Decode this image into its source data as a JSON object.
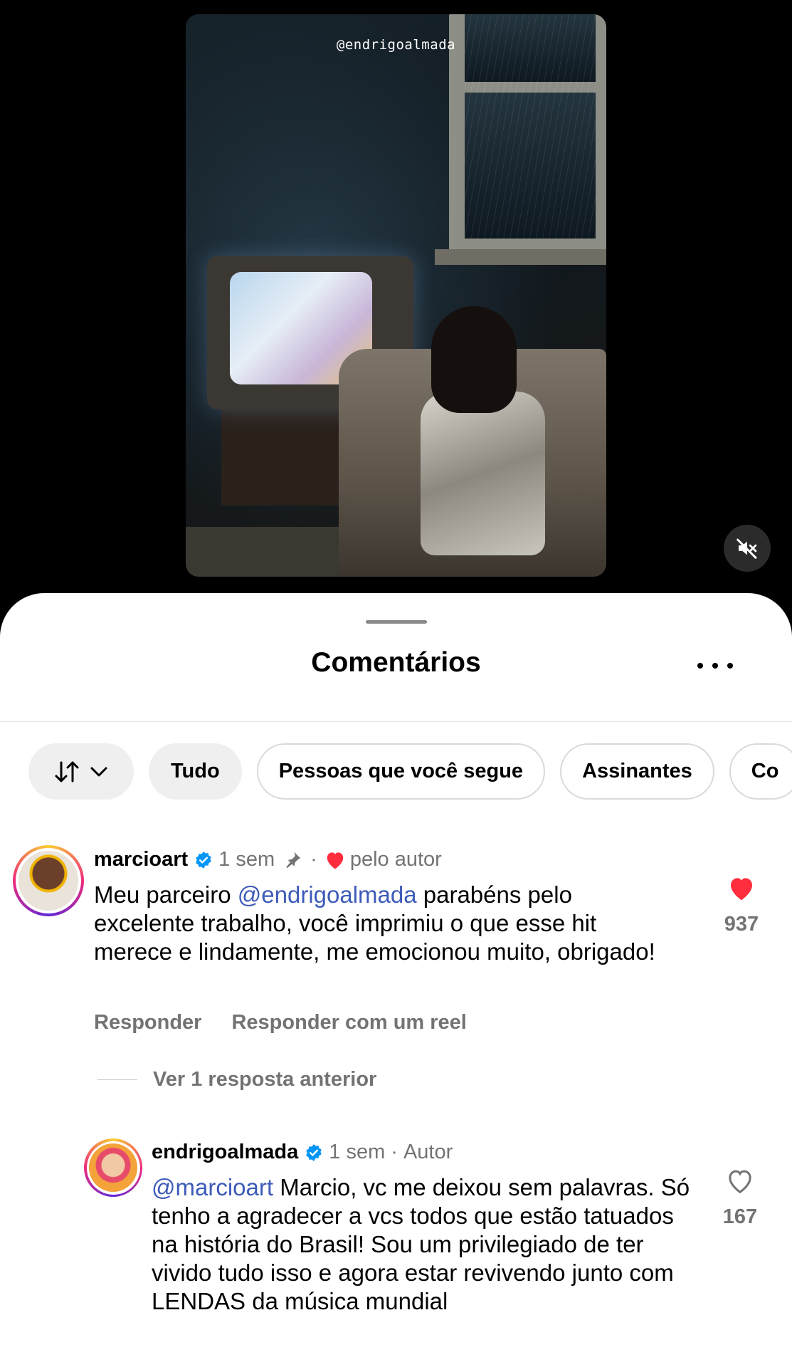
{
  "video": {
    "watermark": "@endrigoalmada",
    "mute_icon": "speaker-muted-icon"
  },
  "sheet": {
    "title": "Comentários",
    "more_icon": "more-horizontal-icon"
  },
  "filters": {
    "sort_icon": "sort-arrows-icon",
    "chips": [
      "Tudo",
      "Pessoas que você segue",
      "Assinantes",
      "Co"
    ]
  },
  "comments": [
    {
      "username": "marcioart",
      "verified": true,
      "time": "1 sem",
      "pinned": true,
      "liked_by_author": "pelo autor",
      "mention": "@endrigoalmada",
      "text_before": "Meu parceiro ",
      "text_after": " parabéns pelo excelente trabalho, você imprimiu o que esse hit merece e lindamente, me emocionou muito, obrigado!",
      "like_count": "937",
      "liked": true,
      "reply_label": "Responder",
      "reply_reel_label": "Responder com um reel"
    },
    {
      "username": "endrigoalmada",
      "verified": true,
      "time": "1 sem",
      "role": "Autor",
      "mention": "@marcioart",
      "text_after": " Marcio, vc me deixou sem palavras. Só tenho a agradecer a vcs todos que estão tatuados na história do Brasil! Sou um privilegiado de ter vivido tudo isso e agora estar revivendo junto com LENDAS da música mundial",
      "like_count": "167",
      "liked": false
    }
  ],
  "view_previous_replies": "Ver 1 resposta anterior",
  "colors": {
    "accent_link": "#3d5bb8",
    "verified": "#0095f6",
    "heart": "#ff2d3d",
    "secondary_text": "#737373"
  }
}
